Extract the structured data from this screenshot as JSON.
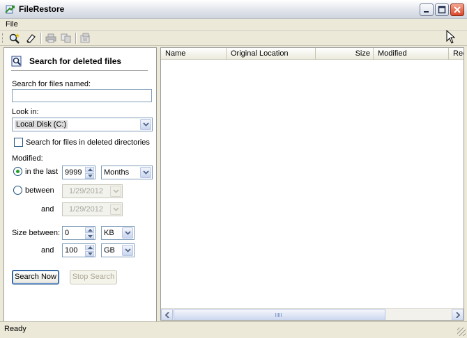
{
  "window": {
    "title": "FileRestore"
  },
  "menu": {
    "items": [
      "File"
    ]
  },
  "toolbar": {
    "icons": [
      "search-icon",
      "eraser-icon",
      "print-icon",
      "copy-icon",
      "properties-icon"
    ]
  },
  "search_panel": {
    "heading": "Search for deleted files",
    "files_named_label": "Search for files named:",
    "files_named_value": "",
    "look_in_label": "Look in:",
    "look_in_value": "Local Disk (C:)",
    "deleted_dirs_label": "Search for files in deleted directories",
    "deleted_dirs_checked": false,
    "modified_label": "Modified:",
    "in_the_last_label": "in the last",
    "in_the_last_value": "9999",
    "in_the_last_unit": "Months",
    "between_label": "between",
    "between_from": "1/29/2012",
    "and_label": "and",
    "between_to": "1/29/2012",
    "size_between_label": "Size between:",
    "size_min_value": "0",
    "size_min_unit": "KB",
    "size_and_label": "and",
    "size_max_value": "100",
    "size_max_unit": "GB",
    "search_now_label": "Search Now",
    "stop_search_label": "Stop Search"
  },
  "results": {
    "columns": [
      "Name",
      "Original Location",
      "Size",
      "Modified",
      "Rec"
    ]
  },
  "status": {
    "text": "Ready"
  },
  "colors": {
    "title_bar": "#dfe3ea",
    "window_bg": "#ece9d8",
    "field_border": "#7f9db9",
    "close_button": "#d9482b"
  }
}
